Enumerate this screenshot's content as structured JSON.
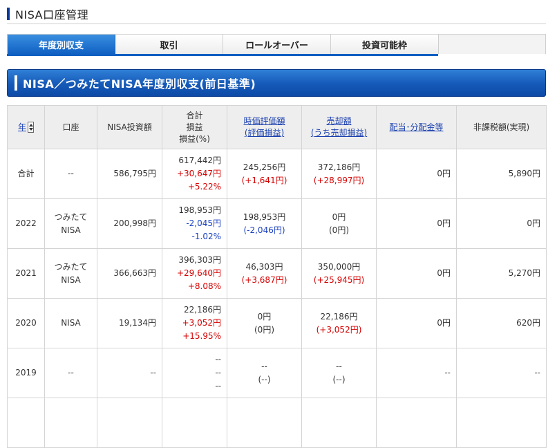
{
  "page": {
    "title": "NISA口座管理"
  },
  "tabs": [
    {
      "label": "年度別収支",
      "active": true
    },
    {
      "label": "取引",
      "active": false
    },
    {
      "label": "ロールオーバー",
      "active": false
    },
    {
      "label": "投資可能枠",
      "active": false
    }
  ],
  "section": {
    "title": "NISA／つみたてNISA年度別収支(前日基準)"
  },
  "table": {
    "headers": {
      "year": "年",
      "account": "口座",
      "investment": "NISA投資額",
      "total_line1": "合計",
      "total_line2": "損益",
      "total_line3": "損益(%)",
      "valuation_line1": "時価評価額",
      "valuation_line2": "(評価損益)",
      "sales_line1": "売却額",
      "sales_line2": "(うち売却損益)",
      "dividend": "配当･分配金等",
      "taxfree": "非課税額(実現)"
    },
    "rows": [
      {
        "year": "合計",
        "account": "--",
        "account2": "",
        "investment": "586,795円",
        "total": "617,442円",
        "total_pl": "+30,647円",
        "total_pct": "+5.22%",
        "valuation": "245,256円",
        "valuation_pl": "(+1,641円)",
        "sales": "372,186円",
        "sales_pl": "(+28,997円)",
        "dividend": "0円",
        "taxfree": "5,890円"
      },
      {
        "year": "2022",
        "account": "つみたて",
        "account2": "NISA",
        "investment": "200,998円",
        "total": "198,953円",
        "total_pl": "-2,045円",
        "total_pct": "-1.02%",
        "valuation": "198,953円",
        "valuation_pl": "(-2,046円)",
        "sales": "0円",
        "sales_pl": "(0円)",
        "dividend": "0円",
        "taxfree": "0円"
      },
      {
        "year": "2021",
        "account": "つみたて",
        "account2": "NISA",
        "investment": "366,663円",
        "total": "396,303円",
        "total_pl": "+29,640円",
        "total_pct": "+8.08%",
        "valuation": "46,303円",
        "valuation_pl": "(+3,687円)",
        "sales": "350,000円",
        "sales_pl": "(+25,945円)",
        "dividend": "0円",
        "taxfree": "5,270円"
      },
      {
        "year": "2020",
        "account": "NISA",
        "account2": "",
        "investment": "19,134円",
        "total": "22,186円",
        "total_pl": "+3,052円",
        "total_pct": "+15.95%",
        "valuation": "0円",
        "valuation_pl": "(0円)",
        "sales": "22,186円",
        "sales_pl": "(+3,052円)",
        "dividend": "0円",
        "taxfree": "620円"
      },
      {
        "year": "2019",
        "account": "--",
        "account2": "",
        "investment": "--",
        "total": "--",
        "total_pl": "--",
        "total_pct": "--",
        "valuation": "--",
        "valuation_pl": "(--)",
        "sales": "--",
        "sales_pl": "(--)",
        "dividend": "--",
        "taxfree": "--"
      }
    ]
  },
  "colors": {
    "accent": "#0f5fc2",
    "positive": "#d60000",
    "negative": "#1a3fbf"
  }
}
